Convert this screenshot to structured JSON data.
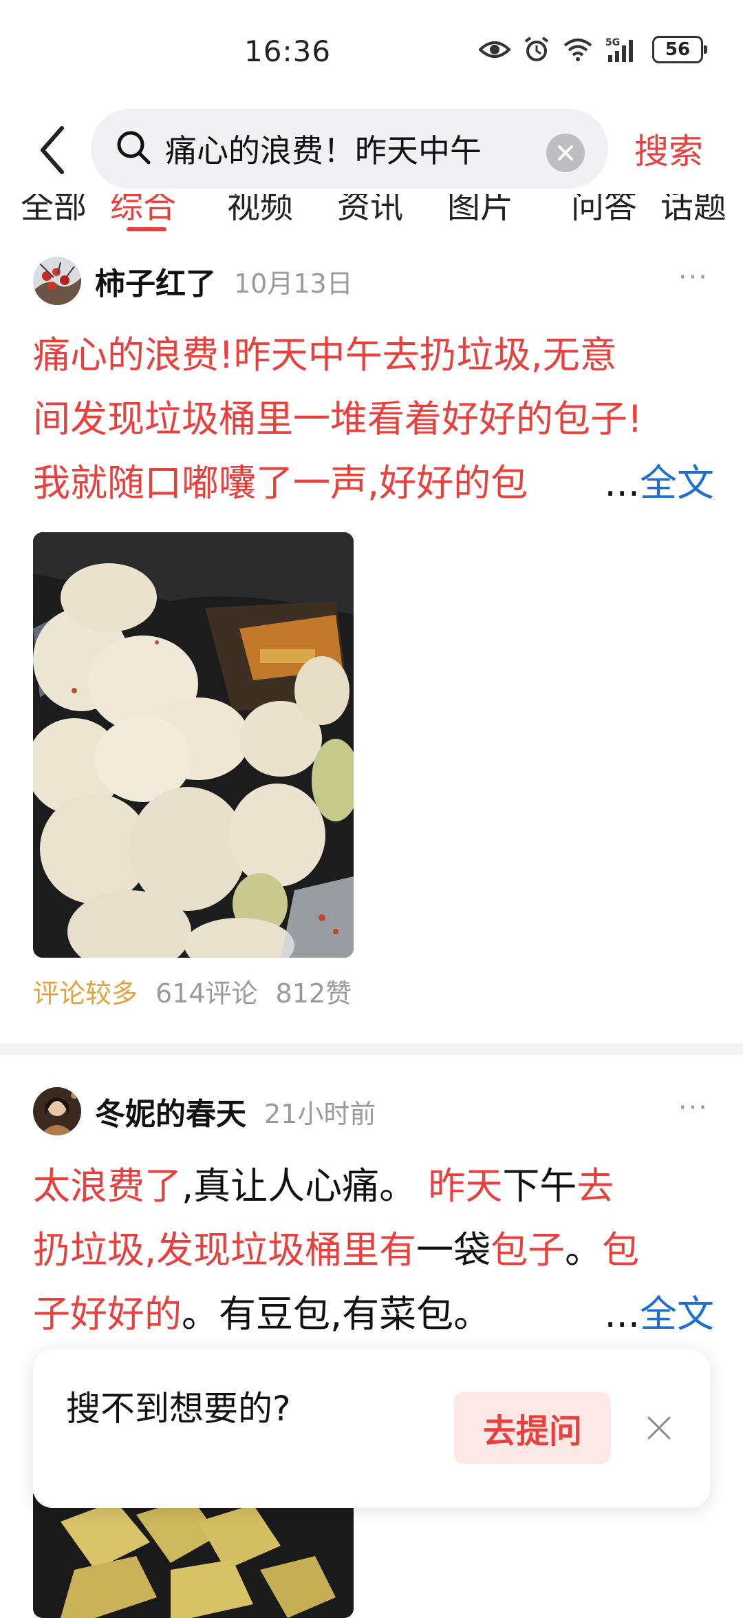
{
  "status_bar": {
    "time": "16:36",
    "network": "5G",
    "battery": "56",
    "icons": [
      "eye-icon",
      "alarm-icon",
      "wifi-icon",
      "5g-signal-icon",
      "battery-icon"
    ]
  },
  "search": {
    "query": "痛心的浪费！昨天中午",
    "submit_label": "搜索"
  },
  "tabs": [
    {
      "label": "全部",
      "active": false
    },
    {
      "label": "综合",
      "active": true
    },
    {
      "label": "视频",
      "active": false
    },
    {
      "label": "资讯",
      "active": false
    },
    {
      "label": "图片",
      "active": false
    },
    {
      "label": "问答",
      "active": false
    },
    {
      "label": "话题",
      "active": false
    }
  ],
  "posts": [
    {
      "author": "柿子红了",
      "time": "10月13日",
      "more": "···",
      "lines": [
        "痛心的浪费!昨天中午去扔垃圾,无意",
        "间发现垃圾桶里一堆看着好好的包子!",
        "我就随口嘟囔了一声,好好的包"
      ],
      "ellipsis": "...",
      "full_text_label": "全文",
      "meta": {
        "hot_tag": "评论较多",
        "comments": "614评论",
        "likes": "812赞"
      }
    },
    {
      "author": "冬妮的春天",
      "time": "21小时前",
      "more": "···",
      "line1": {
        "s1": "太浪费了",
        "s2": ",真让人心痛。 ",
        "s3": "昨天",
        "s4": "下午",
        "s5": "去"
      },
      "line2": {
        "s1": "扔垃圾,发现垃圾桶里有",
        "s2": "一袋",
        "s3": "包子",
        "s4": "。",
        "s5": "包"
      },
      "line3": {
        "s1": "子好好的",
        "s2": "。有豆包,有菜包。"
      },
      "ellipsis": "...",
      "full_text_label": "全文"
    }
  ],
  "prompt_card": {
    "text": "搜不到想要的?",
    "button": "去提问"
  }
}
